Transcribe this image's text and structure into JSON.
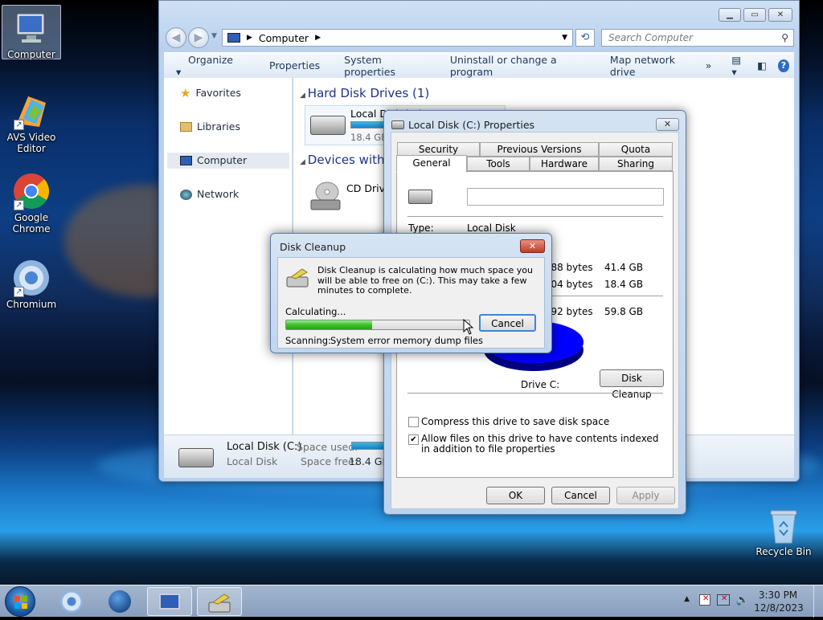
{
  "desktop": {
    "icons": [
      {
        "label": "Computer",
        "icon": "computer-icon"
      },
      {
        "label": "AVS Video Editor",
        "icon": "avs-video-editor-icon"
      },
      {
        "label": "Google Chrome",
        "icon": "chrome-icon"
      },
      {
        "label": "Chromium",
        "icon": "chromium-icon"
      },
      {
        "label": "Recycle Bin",
        "icon": "recycle-bin-icon"
      }
    ]
  },
  "explorer": {
    "address": {
      "segment": "Computer"
    },
    "search_placeholder": "Search Computer",
    "toolbar": {
      "organize": "Organize",
      "properties": "Properties",
      "system_properties": "System properties",
      "uninstall": "Uninstall or change a program",
      "map_drive": "Map network drive",
      "more": "»"
    },
    "nav": {
      "favorites": "Favorites",
      "libraries": "Libraries",
      "computer": "Computer",
      "network": "Network"
    },
    "groups": {
      "hdd": "Hard Disk Drives (1)",
      "removable": "Devices with Removable Storage (1)"
    },
    "drives": {
      "local_disk_name": "Local Disk (C:)",
      "local_disk_free": "18.4 GB",
      "local_disk_used_fraction": 0.69,
      "cd_drive": "CD Drive"
    },
    "details": {
      "name": "Local Disk (C:)",
      "type": "Local Disk",
      "space_used_label": "Space used:",
      "space_free_label": "Space free:",
      "space_free_value": "18.4 GB"
    }
  },
  "properties_dialog": {
    "title": "Local Disk (C:) Properties",
    "tabs_row1": [
      "Security",
      "Previous Versions",
      "Quota"
    ],
    "tabs_row2": [
      "General",
      "Tools",
      "Hardware",
      "Sharing"
    ],
    "active_tab": "General",
    "name_value": "",
    "type_label": "Type:",
    "type_value": "Local Disk",
    "rows": [
      {
        "bytes": "...88 bytes",
        "size": "41.4 GB"
      },
      {
        "bytes": "...04 bytes",
        "size": "18.4 GB"
      },
      {
        "bytes": "...92 bytes",
        "size": "59.8 GB"
      }
    ],
    "pie": {
      "used_fraction": 0.69,
      "used_color": "#0000ff",
      "free_color": "#ff00ff"
    },
    "drive_label": "Drive C:",
    "disk_cleanup_btn": "Disk Cleanup",
    "compress_label": "Compress this drive to save disk space",
    "compress_checked": false,
    "index_label": "Allow files on this drive to have contents indexed in addition to file properties",
    "index_checked": true,
    "ok": "OK",
    "cancel": "Cancel",
    "apply": "Apply"
  },
  "disk_cleanup": {
    "title": "Disk Cleanup",
    "message": "Disk Cleanup is calculating how much space you will be able to free on  (C:). This may take a few minutes to complete.",
    "status": "Calculating...",
    "progress": 0.47,
    "cancel": "Cancel",
    "scanning_label": "Scanning:",
    "scanning_item": "System error memory dump files"
  },
  "taskbar": {
    "time": "3:30 PM",
    "date": "12/8/2023"
  }
}
